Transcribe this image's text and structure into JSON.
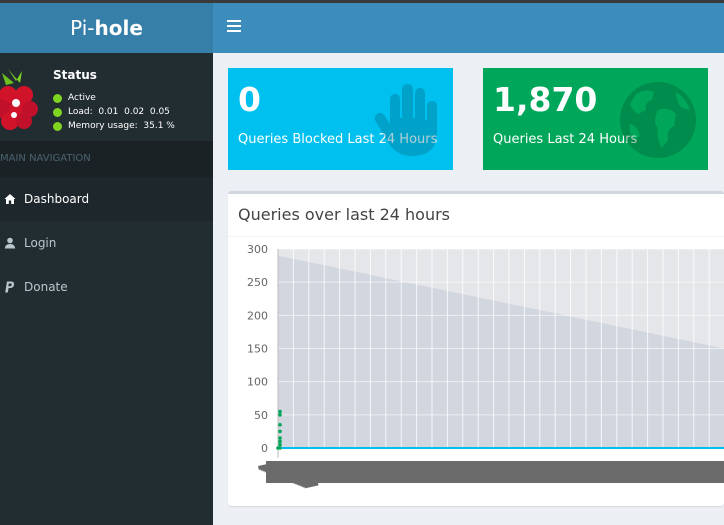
{
  "header": {
    "logo_prefix": "Pi-",
    "logo_bold": "hole",
    "toggle_icon": "bars-icon"
  },
  "sidebar": {
    "status_title": "Status",
    "status_items": [
      {
        "label": "Active",
        "color": "#7fd321"
      },
      {
        "label": "Load:  0.01  0.02  0.05",
        "color": "#7fd321"
      },
      {
        "label": "Memory usage:  35.1 %",
        "color": "#7fd321"
      }
    ],
    "nav_header": "MAIN NAVIGATION",
    "items": [
      {
        "label": "Dashboard",
        "icon": "home-icon",
        "active": true
      },
      {
        "label": "Login",
        "icon": "user-icon",
        "active": false
      },
      {
        "label": "Donate",
        "icon": "paypal-icon",
        "active": false
      }
    ]
  },
  "stats": {
    "blocked": {
      "value": "0",
      "label": "Queries Blocked Last 24 Hours",
      "color": "#00c0ef",
      "icon": "hand-icon"
    },
    "total": {
      "value": "1,870",
      "label": "Queries Last 24 Hours",
      "color": "#00a65a",
      "icon": "globe-icon"
    }
  },
  "chart_box": {
    "title": "Queries over last 24 hours"
  },
  "chart_data": {
    "type": "line",
    "title": "Queries over last 24 hours",
    "xlabel": "",
    "ylabel": "",
    "ylim": [
      0,
      300
    ],
    "yticks": [
      0,
      50,
      100,
      150,
      200,
      250,
      300
    ],
    "grid": true,
    "series": [
      {
        "color": "#00a65a",
        "values": [
          0,
          55,
          50,
          35,
          25,
          15,
          10,
          5
        ]
      },
      {
        "color": "#00c0ef",
        "values": [
          0,
          0,
          0,
          0,
          0,
          0,
          0,
          0
        ]
      }
    ],
    "area_series": {
      "color": "#d2d6de",
      "values": [
        290,
        150
      ]
    }
  }
}
